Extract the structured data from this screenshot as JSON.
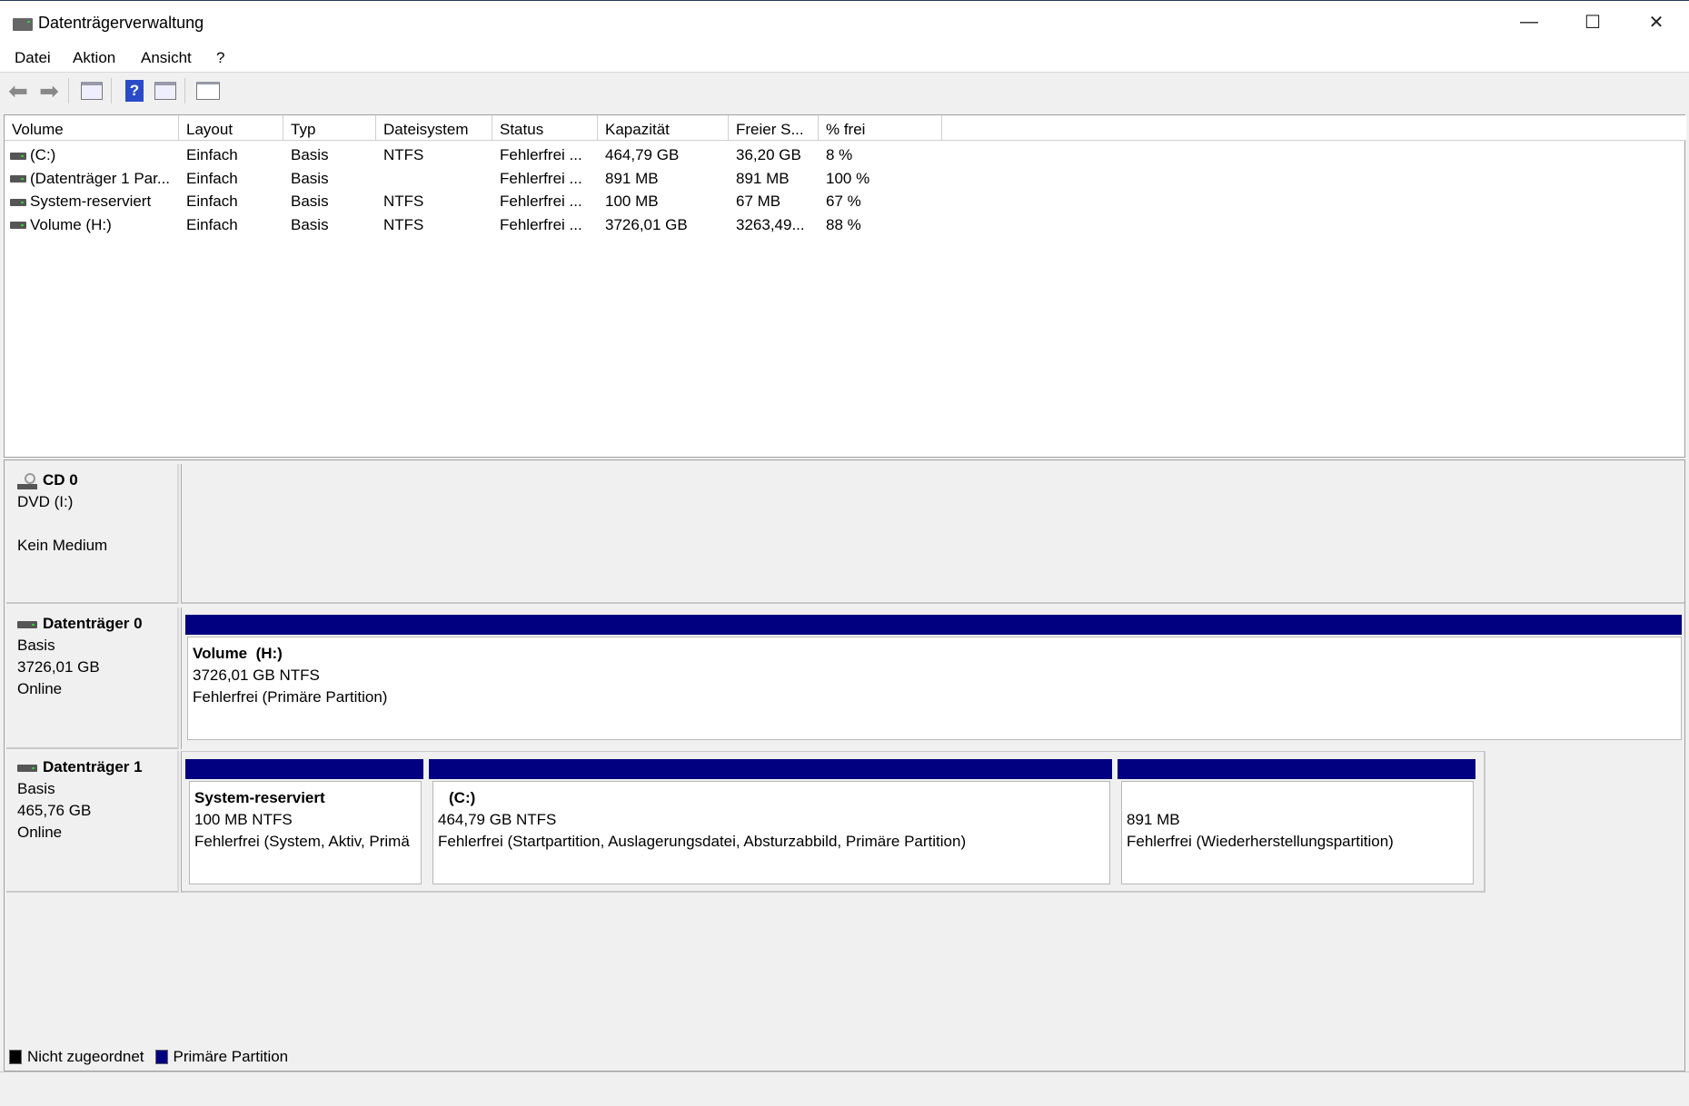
{
  "window": {
    "title": "Datenträgerverwaltung"
  },
  "menu": [
    "Datei",
    "Aktion",
    "Ansicht",
    "?"
  ],
  "toolbar": [
    "back-icon",
    "forward-icon",
    "console-tree-icon",
    "help-icon",
    "action-pane-icon",
    "properties-icon"
  ],
  "table": {
    "columns": [
      "Volume",
      "Layout",
      "Typ",
      "Dateisystem",
      "Status",
      "Kapazität",
      "Freier S...",
      "% frei"
    ],
    "rows": [
      [
        "(C:)",
        "Einfach",
        "Basis",
        "NTFS",
        "Fehlerfrei ...",
        "464,79 GB",
        "36,20 GB",
        "8 %"
      ],
      [
        "(Datenträger 1 Par...",
        "Einfach",
        "Basis",
        "",
        "Fehlerfrei ...",
        "891 MB",
        "891 MB",
        "100 %"
      ],
      [
        "System-reserviert",
        "Einfach",
        "Basis",
        "NTFS",
        "Fehlerfrei ...",
        "100 MB",
        "67 MB",
        "67 %"
      ],
      [
        "Volume (H:)",
        "Einfach",
        "Basis",
        "NTFS",
        "Fehlerfrei ...",
        "3726,01 GB",
        "3263,49...",
        "88 %"
      ]
    ]
  },
  "disks": {
    "cd0": {
      "name": "CD 0",
      "type": "DVD (I:)",
      "status": "Kein Medium"
    },
    "disk0": {
      "name": "Datenträger 0",
      "type": "Basis",
      "size": "3726,01 GB",
      "status": "Online",
      "partitions": [
        {
          "name": "Volume  (H:)",
          "size": "3726,01 GB NTFS",
          "status": "Fehlerfrei (Primäre Partition)"
        }
      ]
    },
    "disk1": {
      "name": "Datenträger 1",
      "type": "Basis",
      "size": "465,76 GB",
      "status": "Online",
      "partitions": [
        {
          "name": "System-reserviert",
          "size": "100 MB NTFS",
          "status": "Fehlerfrei (System, Aktiv, Primä"
        },
        {
          "name": "(C:)",
          "size": "464,79 GB NTFS",
          "status": "Fehlerfrei (Startpartition, Auslagerungsdatei, Absturzabbild, Primäre Partition)"
        },
        {
          "name": "",
          "size": "891 MB",
          "status": "Fehlerfrei (Wiederherstellungspartition)"
        }
      ]
    }
  },
  "legend": [
    {
      "label": "Nicht zugeordnet",
      "color": "#000000"
    },
    {
      "label": "Primäre Partition",
      "color": "#000080"
    }
  ]
}
